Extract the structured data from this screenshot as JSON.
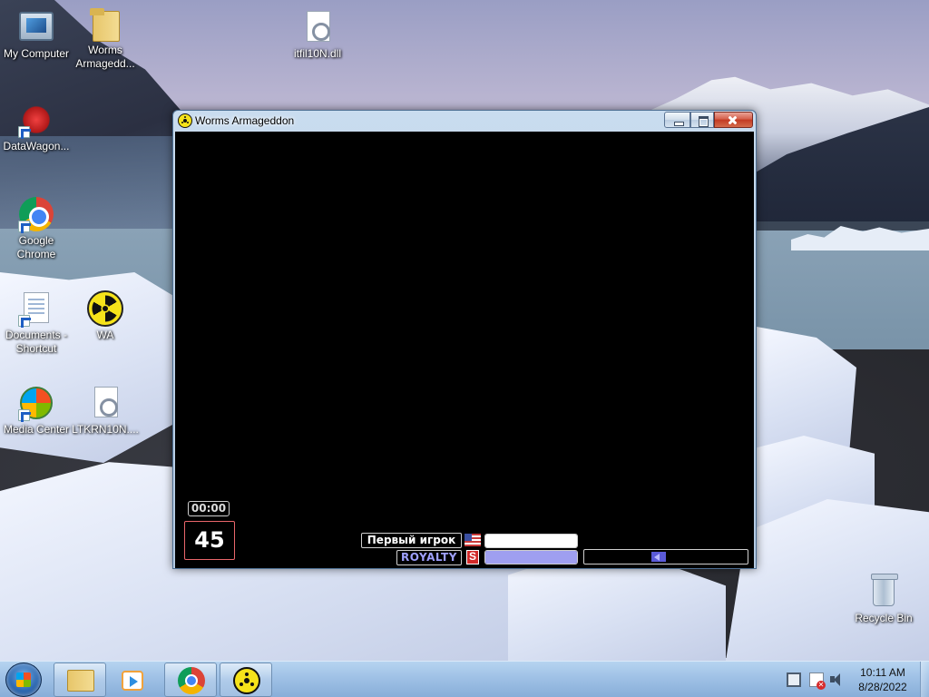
{
  "desktop": {
    "icons": [
      {
        "id": "my-computer",
        "label": "My Computer",
        "icon": "computer-icon"
      },
      {
        "id": "worms-folder",
        "label": "Worms Armagedd...",
        "icon": "folder-icon"
      },
      {
        "id": "itfil10n",
        "label": "itfil10N.dll",
        "icon": "dll-file-icon"
      },
      {
        "id": "datawagon",
        "label": "DataWagon...",
        "icon": "datawagon-icon",
        "shortcut": true
      },
      {
        "id": "google-chrome",
        "label": "Google Chrome",
        "icon": "chrome-icon",
        "shortcut": true
      },
      {
        "id": "documents-shortcut",
        "label": "Documents - Shortcut",
        "icon": "documents-icon",
        "shortcut": true
      },
      {
        "id": "wa",
        "label": "WA",
        "icon": "radioactive-icon"
      },
      {
        "id": "media-center",
        "label": "Media Center",
        "icon": "media-center-icon",
        "shortcut": true
      },
      {
        "id": "ltkrn10n",
        "label": "LTKRN10N....",
        "icon": "dll-file-icon"
      },
      {
        "id": "recycle-bin",
        "label": "Recycle Bin",
        "icon": "recycle-bin-icon"
      }
    ]
  },
  "window": {
    "title": "Worms Armageddon",
    "icon": "radioactive-icon",
    "controls": [
      "minimize",
      "maximize",
      "close"
    ]
  },
  "game": {
    "clock": "00:00",
    "turn_timer": "45",
    "teams": [
      {
        "name": "Первый игрок",
        "flag": "usa-flag-icon",
        "color": "#ffffff",
        "health_fraction": 1.0
      },
      {
        "name": "ROYALTY",
        "flag": "team-s-flag-icon",
        "color": "#9f9ff0",
        "health_fraction": 1.0
      }
    ],
    "wind_fraction": 0.45
  },
  "taskbar": {
    "start": "windows-start-orb",
    "pinned": [
      {
        "id": "explorer",
        "icon": "file-explorer-icon"
      },
      {
        "id": "media-player",
        "icon": "windows-media-player-icon"
      },
      {
        "id": "chrome",
        "icon": "chrome-icon"
      },
      {
        "id": "worms",
        "icon": "radioactive-icon"
      }
    ],
    "tray": {
      "icons": [
        "network-icon",
        "action-center-icon",
        "volume-icon"
      ],
      "time": "10:11 AM",
      "date": "8/28/2022"
    }
  }
}
